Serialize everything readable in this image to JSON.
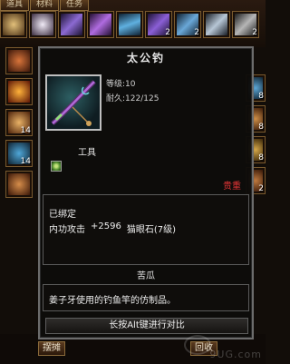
{
  "top_tabs": [
    "道具",
    "材料",
    "任务"
  ],
  "slots": [
    {
      "icon": "armor-icon",
      "count": "",
      "color": "#c9a25c"
    },
    {
      "icon": "pearl-icon",
      "count": "",
      "color": "#cfc7d6"
    },
    {
      "icon": "sword-icon",
      "count": "",
      "color": "#8c6ad2"
    },
    {
      "icon": "feather-blade-icon",
      "count": "",
      "color": "#b06ce0"
    },
    {
      "icon": "fan-icon",
      "count": "",
      "color": "#5fb0e0"
    },
    {
      "icon": "scroll-icon",
      "count": "2",
      "color": "#8b5fd6"
    },
    {
      "icon": "arrow-icon",
      "count": "2",
      "color": "#6aa8d8"
    },
    {
      "icon": "spear-icon",
      "count": "",
      "color": "#b7c7d6"
    },
    {
      "icon": "staff-icon",
      "count": "2",
      "color": "#b6b6b6"
    }
  ],
  "side_slots": [
    {
      "icon": "meat-icon",
      "count": ""
    },
    {
      "icon": "fire-icon",
      "count": ""
    },
    {
      "icon": "horn-icon",
      "count": "14"
    },
    {
      "icon": "jar-icon",
      "count": "14"
    },
    {
      "icon": "fist-icon",
      "count": ""
    }
  ],
  "right_slots": [
    {
      "icon": "bottle-icon",
      "count": "8"
    },
    {
      "icon": "chest-icon",
      "count": "8"
    },
    {
      "icon": "book-icon",
      "count": "8"
    },
    {
      "icon": "bag-icon",
      "count": "2"
    }
  ],
  "tooltip": {
    "title": "太公钓",
    "stats": [
      {
        "label": "等级",
        "value": ":10"
      },
      {
        "label": "耐久",
        "value": ":122/125"
      }
    ],
    "type_label": "工具",
    "rarity": "贵重",
    "bound_label": "已绑定",
    "attribute": "内功攻击",
    "attribute_value": "+2596",
    "gem": "猫眼石(7级)",
    "subtitle": "苦瓜",
    "description": "姜子牙使用的钓鱼竿的仿制品。",
    "compare_hint": "长按Alt键进行对比"
  },
  "bottom_buttons": [
    "摆摊",
    "回收"
  ],
  "watermark": "9UG.com"
}
